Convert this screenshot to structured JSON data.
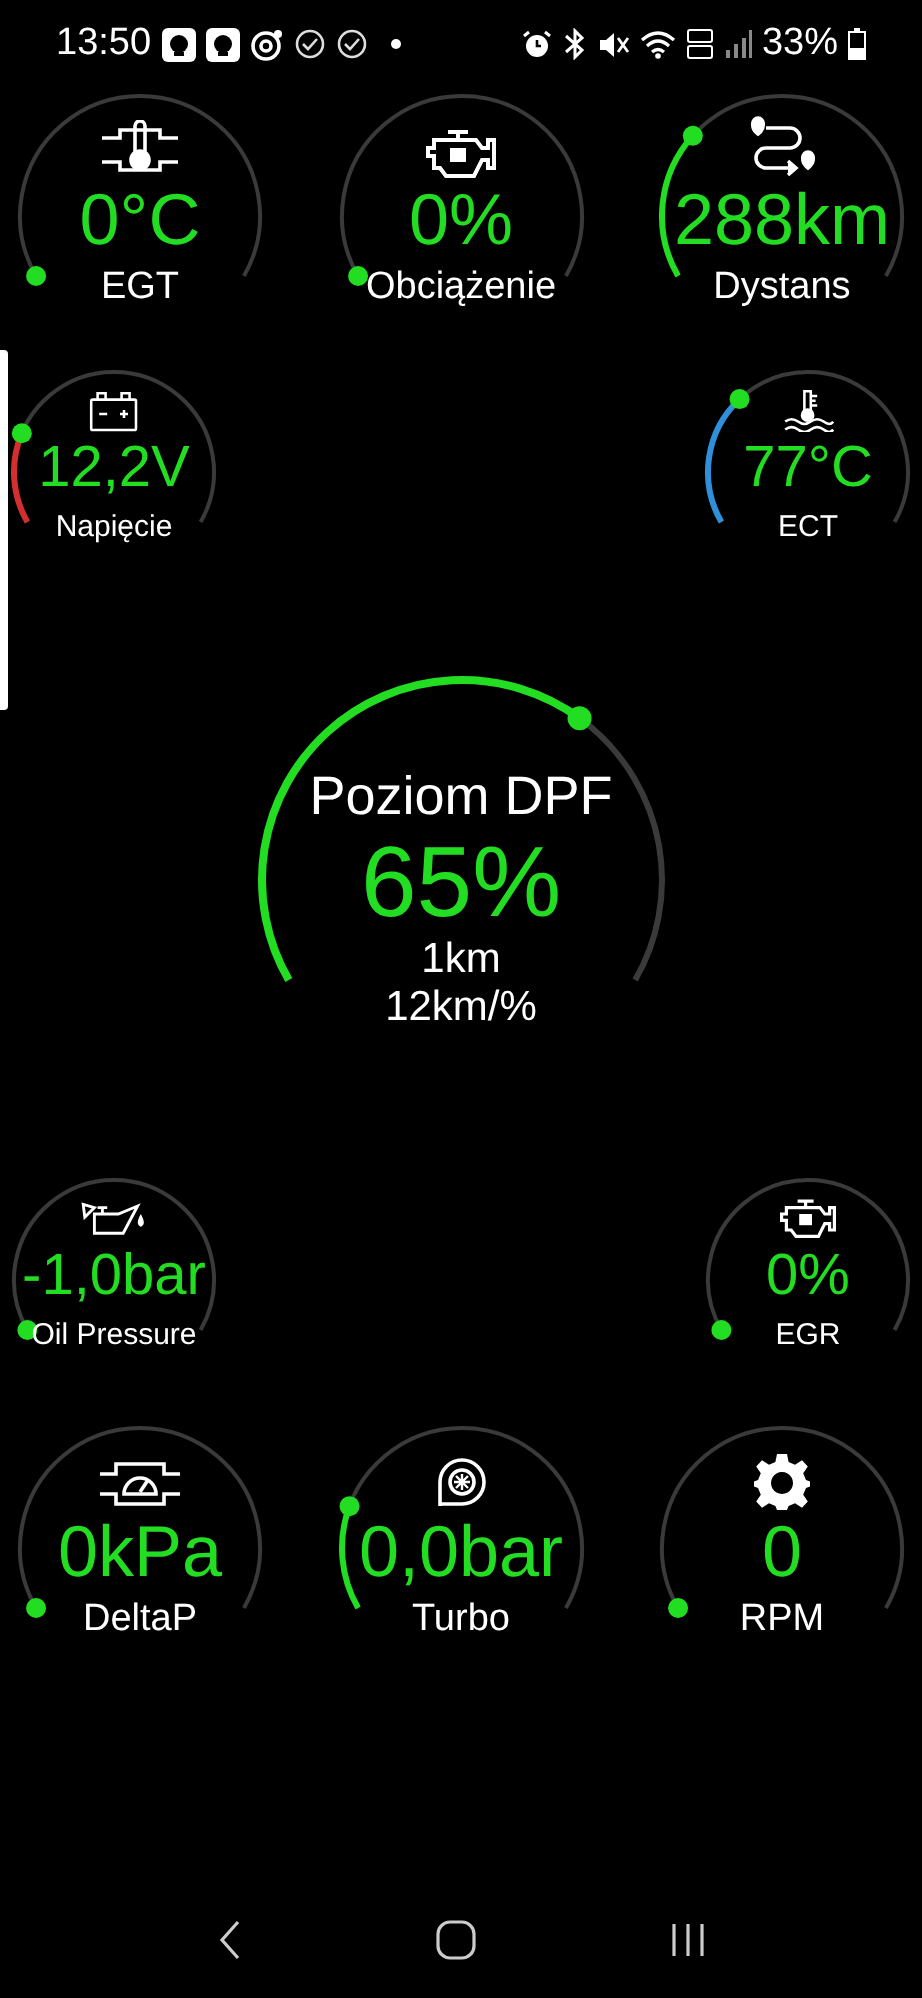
{
  "status_bar": {
    "time": "13:50",
    "battery": "33%"
  },
  "top_row": [
    {
      "kind": "egt",
      "value": "0°C",
      "label": "EGT"
    },
    {
      "kind": "engine",
      "value": "0%",
      "label": "Obciążenie"
    },
    {
      "kind": "route",
      "value": "288km",
      "label": "Dystans",
      "color": "#22dd22"
    }
  ],
  "side_row": [
    {
      "kind": "battery",
      "value": "12,2V",
      "label": "Napięcie",
      "color": "#d32f2f"
    },
    {
      "kind": "coolant",
      "value": "77°C",
      "label": "ECT",
      "color": "#2f8fd8"
    }
  ],
  "dpf": {
    "title": "Poziom DPF",
    "value": "65%",
    "distance": "1km",
    "rate": "12km/%"
  },
  "lower_side_row": [
    {
      "kind": "oil",
      "value": "-1,0bar",
      "label": "Oil Pressure"
    },
    {
      "kind": "engine",
      "value": "0%",
      "label": "EGR"
    }
  ],
  "bottom_row": [
    {
      "kind": "deltap",
      "value": "0kPa",
      "label": "DeltaP"
    },
    {
      "kind": "turbo",
      "value": "0,0bar",
      "label": "Turbo",
      "color": "#22dd22"
    },
    {
      "kind": "gear",
      "value": "0",
      "label": "RPM"
    }
  ]
}
